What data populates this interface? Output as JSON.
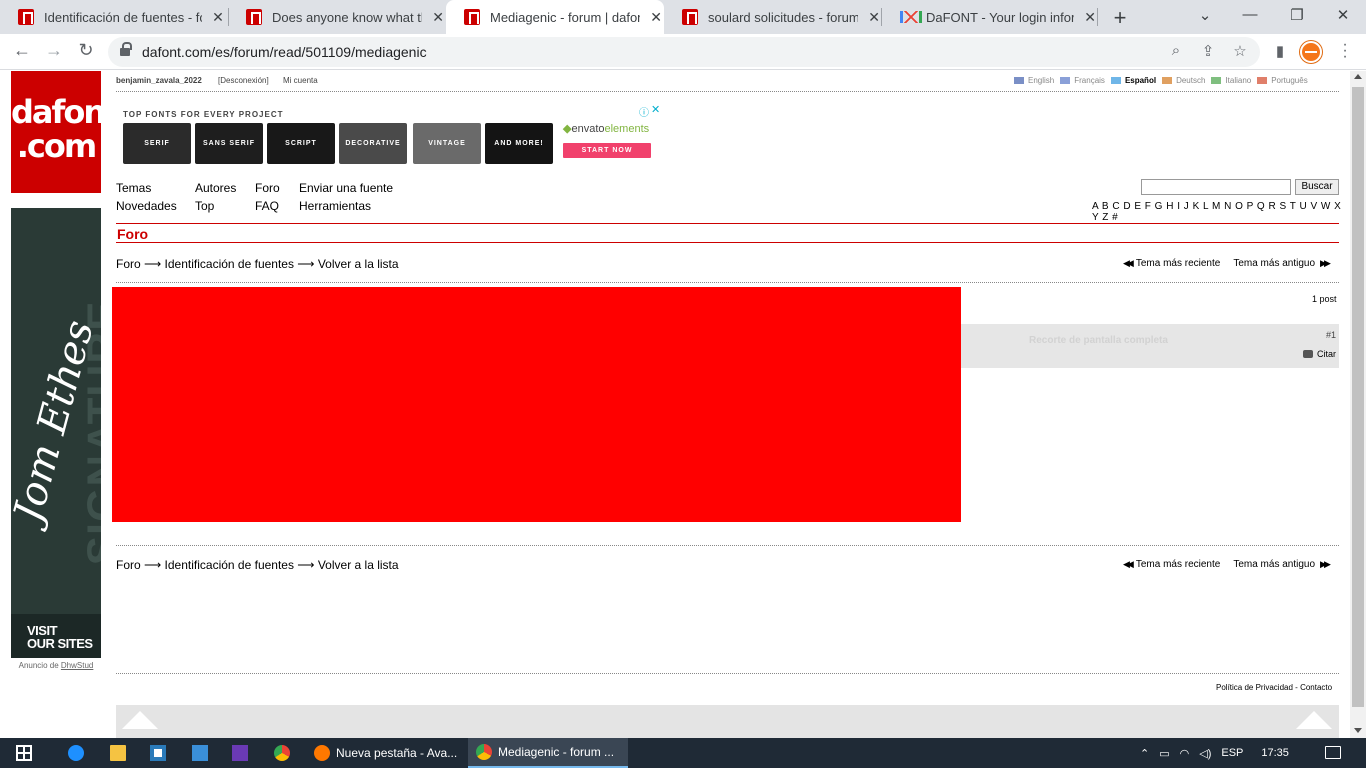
{
  "browser": {
    "tabs": [
      {
        "title": "Identificación de fuentes - fo",
        "active": false
      },
      {
        "title": "Does anyone know what this",
        "active": false
      },
      {
        "title": "Mediagenic - forum | dafont",
        "active": true
      },
      {
        "title": "soulard solicitudes - forum |",
        "active": false
      },
      {
        "title": "DaFONT - Your login informa",
        "active": false
      }
    ],
    "url": "dafont.com/es/forum/read/501109/mediagenic",
    "new_tab_glyph": "+",
    "close_glyph": "✕",
    "window_controls": [
      "⌄",
      "—",
      "❐",
      "✕"
    ]
  },
  "site": {
    "logo_line1": "dafont",
    "logo_line2": ".com",
    "user": "benjamin_zavala_2022",
    "logout": "[Desconexión]",
    "account": "Mi cuenta",
    "languages": [
      {
        "label": "English",
        "active": false,
        "color": "#7a8fc6"
      },
      {
        "label": "Français",
        "active": false,
        "color": "#8aa0d8"
      },
      {
        "label": "Español",
        "active": true,
        "color": "#6fb6e8"
      },
      {
        "label": "Deutsch",
        "active": false,
        "color": "#e0a060"
      },
      {
        "label": "Italiano",
        "active": false,
        "color": "#7fbf7f"
      },
      {
        "label": "Português",
        "active": false,
        "color": "#e07f6a"
      }
    ]
  },
  "banner_ad": {
    "title": "TOP FONTS FOR EVERY PROJECT",
    "tiles": [
      "SERIF",
      "SANS SERIF",
      "SCRIPT",
      "DECORATIVE",
      "VINTAGE",
      "AND MORE!"
    ],
    "brand_prefix": "envato",
    "brand_suffix": "elements",
    "cta": "START NOW",
    "info_glyph": "ⓘ",
    "close_glyph": "✕"
  },
  "nav": {
    "col1": [
      "Temas",
      "Novedades"
    ],
    "col2": [
      "Autores",
      "Top"
    ],
    "col3": [
      "Foro",
      "FAQ"
    ],
    "col4": [
      "Enviar una fuente",
      "Herramientas"
    ],
    "search_button": "Buscar",
    "alphabet": "A B C D E F G H I J K L M N O P Q R S T U V W X Y Z #"
  },
  "forum": {
    "section_title": "Foro",
    "breadcrumb": "Foro ⟶ Identificación de fuentes ⟶ Volver a la lista",
    "newer": "Tema más reciente",
    "older": "Tema más antiguo",
    "post_count": "1 post",
    "post_number": "#1",
    "post_faint_text": "Recorte de pantalla completa",
    "quote": "Citar"
  },
  "side_ad": {
    "cta_line1": "VISIT",
    "cta_line2": "OUR SITES",
    "note_prefix": "Anuncio de",
    "note_link": "DhwStud"
  },
  "footer": {
    "privacy": "Política de Privacidad",
    "separator": "-",
    "contact": "Contacto"
  },
  "taskbar": {
    "apps": [
      {
        "label": "Nueva pestaña - Ava...",
        "active": false
      },
      {
        "label": "Mediagenic - forum ...",
        "active": true
      }
    ],
    "language": "ESP",
    "time": "17:35"
  }
}
